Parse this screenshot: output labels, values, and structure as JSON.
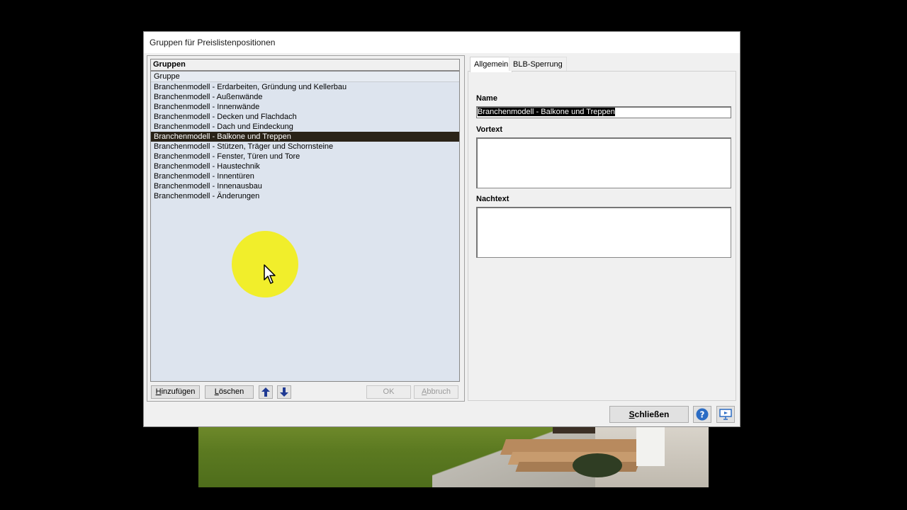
{
  "window": {
    "title": "Gruppen für Preislistenpositionen"
  },
  "groups_panel": {
    "heading": "Gruppen",
    "column_header": "Gruppe",
    "items": [
      "Branchenmodell - Erdarbeiten, Gründung und Kellerbau",
      "Branchenmodell - Außenwände",
      "Branchenmodell - Innenwände",
      "Branchenmodell - Decken und Flachdach",
      "Branchenmodell - Dach und Eindeckung",
      "Branchenmodell - Balkone und Treppen",
      "Branchenmodell - Stützen, Träger und Schornsteine",
      "Branchenmodell - Fenster, Türen und Tore",
      "Branchenmodell - Haustechnik",
      "Branchenmodell - Innentüren",
      "Branchenmodell - Innenausbau",
      "Branchenmodell - Änderungen"
    ],
    "selected_item": "Branchenmodell - Balkone und Treppen",
    "buttons": {
      "add_label": "Hinzufügen",
      "delete_label": "Löschen",
      "up_icon": "arrow-up-icon",
      "down_icon": "arrow-down-icon",
      "ok_label": "OK",
      "cancel_label": "Abbruch"
    }
  },
  "details_panel": {
    "tabs": [
      "Allgemein",
      "BLB-Sperrung"
    ],
    "active_tab": "Allgemein",
    "name_label": "Name",
    "name_value": "Branchenmodell - Balkone und Treppen",
    "vortext_label": "Vortext",
    "vortext_value": "",
    "nachtext_label": "Nachtext",
    "nachtext_value": ""
  },
  "footer": {
    "close_label": "Schließen",
    "help_icon": "help-icon",
    "presentation_icon": "presentation-icon"
  },
  "colors": {
    "list_background": "#dde4ee",
    "selection_background": "#2a2318",
    "cursor_highlight": "#f2ef1a"
  }
}
